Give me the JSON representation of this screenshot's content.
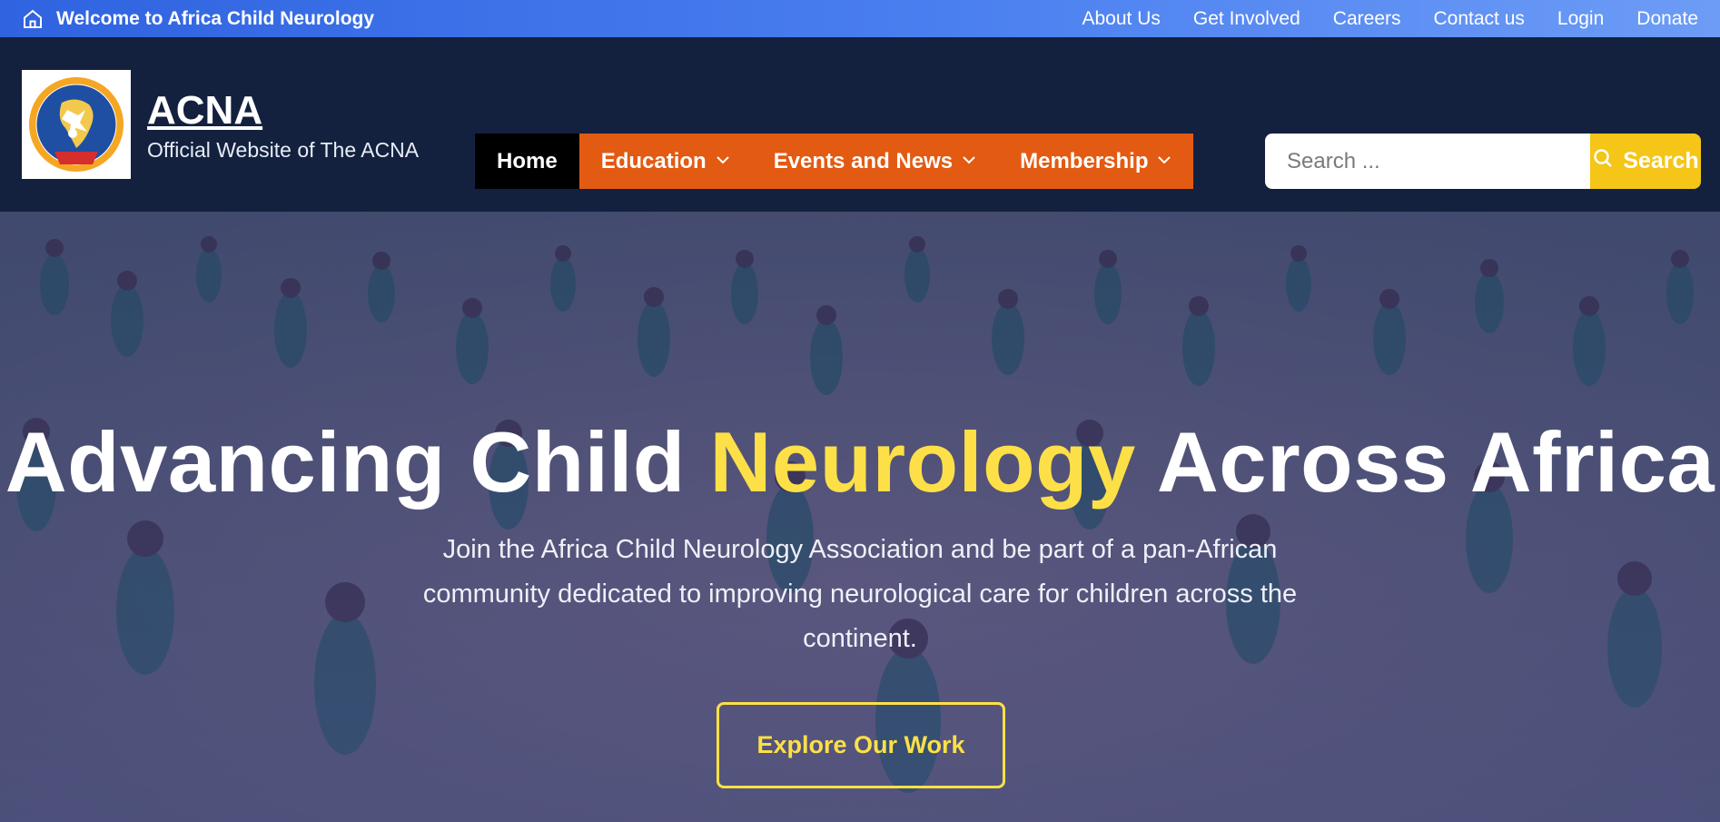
{
  "topbar": {
    "welcome": "Welcome to Africa Child Neurology",
    "links": [
      "About Us",
      "Get Involved",
      "Careers",
      "Contact us",
      "Login",
      "Donate"
    ]
  },
  "header": {
    "logo_alt": "ACNA",
    "title": "ACNA",
    "tagline": "Official Website of The ACNA"
  },
  "nav": {
    "home": "Home",
    "education": "Education",
    "events": "Events and News",
    "membership": "Membership"
  },
  "search": {
    "placeholder": "Search ...",
    "button": "Search"
  },
  "hero": {
    "title_pre": "Advancing Child ",
    "title_highlight": "Neurology",
    "title_post": " Across Africa",
    "subtitle": "Join the Africa Child Neurology Association and be part of a pan-African community dedicated to improving neurological care for children across the continent.",
    "cta": "Explore Our Work"
  },
  "colors": {
    "topbar": "#3b6ee6",
    "header_bg": "#13213f",
    "nav_orange": "#e35a12",
    "nav_active": "#000000",
    "accent_yellow": "#fde047",
    "search_button": "#f5c518"
  },
  "icons": {
    "home": "home-icon",
    "chevron": "chevron-down-icon",
    "search": "search-icon"
  }
}
